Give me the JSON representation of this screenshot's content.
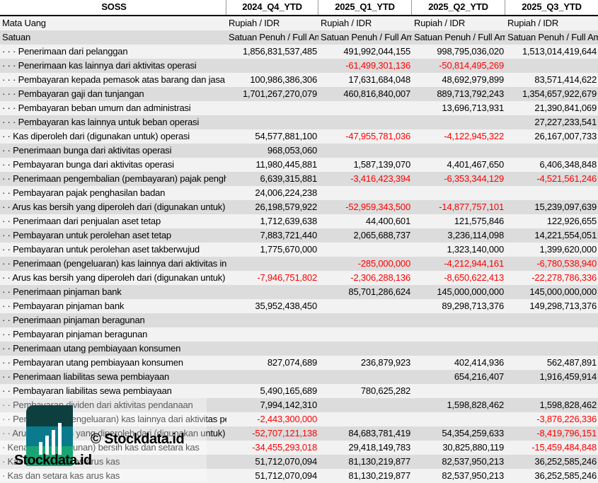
{
  "header": {
    "title": "SOSS",
    "periods": [
      "2024_Q4_YTD",
      "2025_Q1_YTD",
      "2025_Q2_YTD",
      "2025_Q3_YTD"
    ]
  },
  "meta_rows": [
    {
      "label": "Mata Uang",
      "values": [
        "Rupiah / IDR",
        "Rupiah / IDR",
        "Rupiah / IDR",
        "Rupiah / IDR"
      ]
    },
    {
      "label": "Satuan",
      "values": [
        "Satuan Penuh / Full Amount",
        "Satuan Penuh / Full Amount",
        "Satuan Penuh / Full Amount",
        "Satuan Penuh / Full Amount"
      ]
    }
  ],
  "rows": [
    {
      "label": "· · · Penerimaan dari pelanggan",
      "values": [
        "1,856,831,537,485",
        "491,992,044,155",
        "998,795,036,020",
        "1,513,014,419,644"
      ]
    },
    {
      "label": "· · · Penerimaan kas lainnya dari aktivitas operasi",
      "values": [
        "",
        "-61,499,301,136",
        "-50,814,495,269",
        ""
      ]
    },
    {
      "label": "· · · Pembayaran kepada pemasok atas barang dan jasa",
      "values": [
        "100,986,386,306",
        "17,631,684,048",
        "48,692,979,899",
        "83,571,414,622"
      ]
    },
    {
      "label": "· · · Pembayaran gaji dan tunjangan",
      "values": [
        "1,701,267,270,079",
        "460,816,840,007",
        "889,713,792,243",
        "1,354,657,922,679"
      ]
    },
    {
      "label": "· · · Pembayaran beban umum dan administrasi",
      "values": [
        "",
        "",
        "13,696,713,931",
        "21,390,841,069"
      ]
    },
    {
      "label": "· · · Pembayaran kas lainnya untuk beban operasi",
      "values": [
        "",
        "",
        "",
        "27,227,233,541"
      ]
    },
    {
      "label": "· · Kas diperoleh dari (digunakan untuk) operasi",
      "values": [
        "54,577,881,100",
        "-47,955,781,036",
        "-4,122,945,322",
        "26,167,007,733"
      ]
    },
    {
      "label": "· · Penerimaan bunga dari aktivitas operasi",
      "values": [
        "968,053,060",
        "",
        "",
        ""
      ]
    },
    {
      "label": "· · Pembayaran bunga dari aktivitas operasi",
      "values": [
        "11,980,445,881",
        "1,587,139,070",
        "4,401,467,650",
        "6,406,348,848"
      ]
    },
    {
      "label": "· · Penerimaan pengembalian (pembayaran) pajak penghasilan",
      "values": [
        "6,639,315,881",
        "-3,416,423,394",
        "-6,353,344,129",
        "-4,521,561,246"
      ]
    },
    {
      "label": "· · Pembayaran pajak penghasilan badan",
      "values": [
        "24,006,224,238",
        "",
        "",
        ""
      ]
    },
    {
      "label": "· · Arus kas bersih yang diperoleh dari (digunakan untuk)",
      "values": [
        "26,198,579,922",
        "-52,959,343,500",
        "-14,877,757,101",
        "15,239,097,639"
      ]
    },
    {
      "label": "· · Penerimaan dari penjualan aset tetap",
      "values": [
        "1,712,639,638",
        "44,400,601",
        "121,575,846",
        "122,926,655"
      ]
    },
    {
      "label": "· · Pembayaran untuk perolehan aset tetap",
      "values": [
        "7,883,721,440",
        "2,065,688,737",
        "3,236,114,098",
        "14,221,554,051"
      ]
    },
    {
      "label": "· · Pembayaran untuk perolehan aset takberwujud",
      "values": [
        "1,775,670,000",
        "",
        "1,323,140,000",
        "1,399,620,000"
      ]
    },
    {
      "label": "· · Penerimaan (pengeluaran) kas lainnya dari aktivitas investasi",
      "values": [
        "",
        "-285,000,000",
        "-4,212,944,161",
        "-6,780,538,940"
      ]
    },
    {
      "label": "· · Arus kas bersih yang diperoleh dari (digunakan untuk)",
      "values": [
        "-7,946,751,802",
        "-2,306,288,136",
        "-8,650,622,413",
        "-22,278,786,336"
      ]
    },
    {
      "label": "· · Penerimaan pinjaman bank",
      "values": [
        "",
        "85,701,286,624",
        "145,000,000,000",
        "145,000,000,000"
      ]
    },
    {
      "label": "· · Pembayaran pinjaman bank",
      "values": [
        "35,952,438,450",
        "",
        "89,298,713,376",
        "149,298,713,376"
      ]
    },
    {
      "label": "· · Penerimaan pinjaman beragunan",
      "values": [
        "",
        "",
        "",
        ""
      ]
    },
    {
      "label": "· · Pembayaran pinjaman beragunan",
      "values": [
        "",
        "",
        "",
        ""
      ]
    },
    {
      "label": "· · Penerimaan utang pembiayaan konsumen",
      "values": [
        "",
        "",
        "",
        ""
      ]
    },
    {
      "label": "· · Pembayaran utang pembiayaan konsumen",
      "values": [
        "827,074,689",
        "236,879,923",
        "402,414,936",
        "562,487,891"
      ]
    },
    {
      "label": "· · Penerimaan liabilitas sewa pembiayaan",
      "values": [
        "",
        "",
        "654,216,407",
        "1,916,459,914"
      ]
    },
    {
      "label": "· · Pembayaran liabilitas sewa pembiayaan",
      "values": [
        "5,490,165,689",
        "780,625,282",
        "",
        ""
      ]
    },
    {
      "label": "· · Pembayaran dividen dari aktivitas pendanaan",
      "values": [
        "7,994,142,310",
        "",
        "1,598,828,462",
        "1,598,828,462"
      ]
    },
    {
      "label": "· · Penerimaan (pengeluaran) kas lainnya dari aktivitas pendanaan",
      "values": [
        "-2,443,300,000",
        "",
        "",
        "-3,876,226,336"
      ]
    },
    {
      "label": "· · Arus kas bersih yang diperoleh dari (digunakan untuk)",
      "values": [
        "-52,707,121,138",
        "84,683,781,419",
        "54,354,259,633",
        "-8,419,796,151"
      ]
    },
    {
      "label": "· Kenaikan (penurunan) bersih kas dan setara kas",
      "values": [
        "-34,455,293,018",
        "29,418,149,783",
        "30,825,880,119",
        "-15,459,484,848"
      ]
    },
    {
      "label": "· Kas dan setara kas arus kas",
      "values": [
        "51,712,070,094",
        "81,130,219,877",
        "82,537,950,213",
        "36,252,585,246"
      ]
    },
    {
      "label": "· Kas dan setara kas arus kas",
      "values": [
        "51,712,070,094",
        "81,130,219,877",
        "82,537,950,213",
        "36,252,585,246"
      ]
    }
  ],
  "watermark": {
    "copyright": "© Stockdata.id",
    "brand": "Stockdata.id"
  },
  "colors": {
    "negative": "#ff0000",
    "row_light": "#f2f2f2",
    "row_dark": "#dcdcdc",
    "logo_top": "#0e3f3f",
    "logo_mid": "#0a7b8c",
    "logo_bottom": "#17a673"
  }
}
